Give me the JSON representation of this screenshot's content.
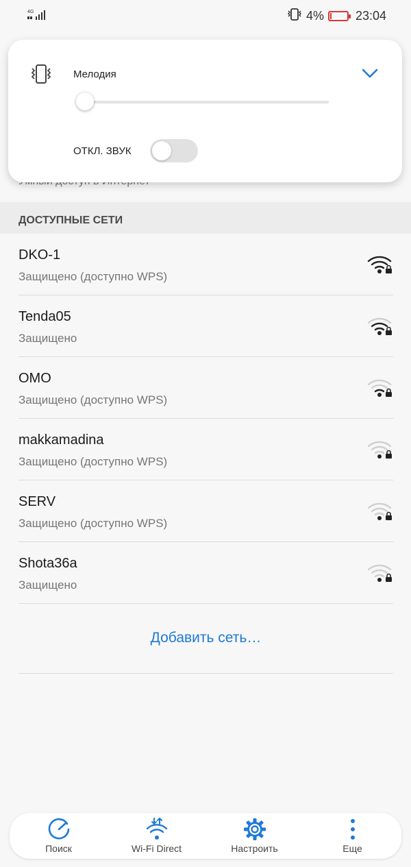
{
  "status_bar": {
    "network": "4G",
    "battery_percent": "4%",
    "battery_level": 0.04,
    "time": "23:04"
  },
  "volume_panel": {
    "title": "Мелодия",
    "mute_label": "ОТКЛ. ЗВУК",
    "mute_enabled": false,
    "volume_level": 0.0,
    "accent_color": "#1e7ad6"
  },
  "hidden_row_text": "Умный доступ в Интернет",
  "section_title": "ДОСТУПНЫЕ СЕТИ",
  "networks": [
    {
      "name": "DKO-1",
      "status": "Защищено (доступно WPS)",
      "signal": 4
    },
    {
      "name": "Tenda05",
      "status": "Защищено",
      "signal": 3
    },
    {
      "name": "OMO",
      "status": "Защищено (доступно WPS)",
      "signal": 2
    },
    {
      "name": "makkamadina",
      "status": "Защищено (доступно WPS)",
      "signal": 1
    },
    {
      "name": "SERV",
      "status": "Защищено (доступно WPS)",
      "signal": 1
    },
    {
      "name": "Shota36a",
      "status": "Защищено",
      "signal": 1
    }
  ],
  "add_network_label": "Добавить сеть…",
  "bottom_nav": [
    {
      "label": "Поиск",
      "icon": "refresh-icon"
    },
    {
      "label": "Wi-Fi Direct",
      "icon": "wifi-direct-icon"
    },
    {
      "label": "Настроить",
      "icon": "gear-icon"
    },
    {
      "label": "Еще",
      "icon": "more-vert-icon"
    }
  ]
}
